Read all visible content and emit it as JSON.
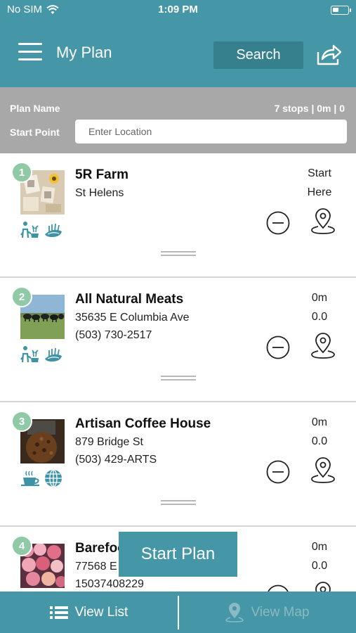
{
  "status": {
    "carrier": "No SIM",
    "time": "1:09 PM"
  },
  "nav": {
    "title": "My Plan",
    "search_label": "Search"
  },
  "plan": {
    "name_label": "Plan Name",
    "stats": "7 stops | 0m | 0",
    "start_label": "Start Point",
    "start_placeholder": "Enter Location"
  },
  "stops": [
    {
      "number": "1",
      "name": "5R Farm",
      "line1": "St Helens",
      "line2": "",
      "meta1": "Start",
      "meta2": "Here",
      "icons": [
        "farm-icon",
        "grain-icon"
      ]
    },
    {
      "number": "2",
      "name": "All Natural Meats",
      "line1": "35635 E Columbia Ave",
      "line2": "(503) 730-2517",
      "meta1": "0m",
      "meta2": "0.0",
      "icons": [
        "farm-icon",
        "grain-icon"
      ]
    },
    {
      "number": "3",
      "name": "Artisan Coffee House",
      "line1": "879 Bridge St",
      "line2": "(503) 429-ARTS",
      "meta1": "0m",
      "meta2": "0.0",
      "icons": [
        "coffee-icon",
        "globe-icon"
      ]
    },
    {
      "number": "4",
      "name": "Barefoot Farmers",
      "line1": "77568 E",
      "line2": "15037408229",
      "meta1": "0m",
      "meta2": "0.0",
      "icons": []
    }
  ],
  "start_plan_label": "Start Plan",
  "tabs": {
    "list_label": "View List",
    "map_label": "View Map"
  },
  "colors": {
    "primary": "#4596a6",
    "primary_dark": "#36808e",
    "plan_bar": "#a8a8a8",
    "badge": "#8fc9a6",
    "icon": "#3f93a6"
  }
}
